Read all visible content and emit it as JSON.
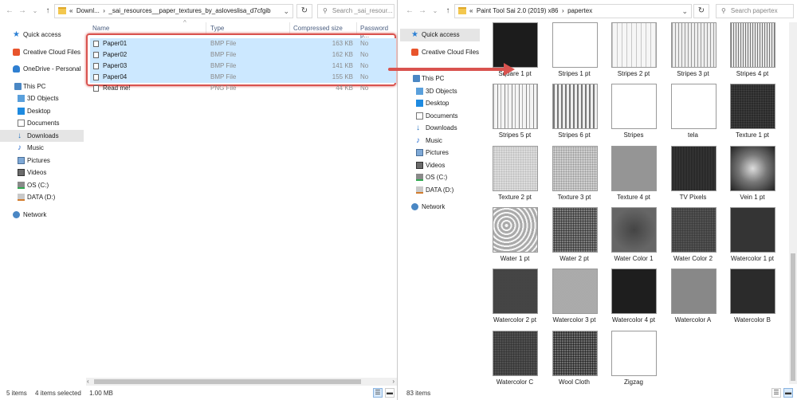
{
  "left": {
    "breadcrumb": [
      "«",
      "Downl...",
      "›",
      "_sai_resources__paper_textures_by_asloveslisa_d7cfgib"
    ],
    "search_placeholder": "Search _sai_resour...",
    "columns": [
      "Name",
      "Type",
      "Compressed size",
      "Password p..."
    ],
    "files": [
      {
        "name": "Paper01",
        "type": "BMP File",
        "size": "163 KB",
        "pw": "No",
        "selected": true
      },
      {
        "name": "Paper02",
        "type": "BMP File",
        "size": "162 KB",
        "pw": "No",
        "selected": true
      },
      {
        "name": "Paper03",
        "type": "BMP File",
        "size": "141 KB",
        "pw": "No",
        "selected": true
      },
      {
        "name": "Paper04",
        "type": "BMP File",
        "size": "155 KB",
        "pw": "No",
        "selected": true
      },
      {
        "name": "Read me!",
        "type": "PNG File",
        "size": "44 KB",
        "pw": "No",
        "selected": false
      }
    ],
    "nav": [
      "Quick access",
      "Creative Cloud Files",
      "OneDrive - Personal",
      "This PC",
      "3D Objects",
      "Desktop",
      "Documents",
      "Downloads",
      "Music",
      "Pictures",
      "Videos",
      "OS (C:)",
      "DATA (D:)",
      "Network"
    ],
    "status": {
      "items": "5 items",
      "selected": "4 items selected",
      "size": "1.00 MB"
    }
  },
  "right": {
    "breadcrumb": [
      "«",
      "Paint Tool Sai 2.0 (2019) x86",
      "›",
      "papertex"
    ],
    "search_placeholder": "Search papertex",
    "nav": [
      "Quick access",
      "Creative Cloud Files",
      "This PC",
      "3D Objects",
      "Desktop",
      "Documents",
      "Downloads",
      "Music",
      "Pictures",
      "Videos",
      "OS (C:)",
      "DATA (D:)",
      "Network"
    ],
    "thumbnails": [
      "Square 1 pt",
      "Stripes 1 pt",
      "Stripes 2 pt",
      "Stripes 3 pt",
      "Stripes 4 pt",
      "Stripes 5 pt",
      "Stripes 6 pt",
      "Stripes",
      "tela",
      "Texture 1 pt",
      "Texture 2 pt",
      "Texture 3 pt",
      "Texture 4 pt",
      "TV Pixels",
      "Vein 1 pt",
      "Water 1 pt",
      "Water 2 pt",
      "Water Color 1",
      "Water Color 2",
      "Watercolor 1 pt",
      "Watercolor 2 pt",
      "Watercolor 3 pt",
      "Watercolor 4 pt",
      "Watercolor A",
      "Watercolor B",
      "Watercolor C",
      "Wool Cloth",
      "Zigzag"
    ],
    "status": {
      "items": "83 items"
    }
  },
  "colors": {
    "selection": "#cce8ff",
    "annotation": "#d9534f"
  }
}
